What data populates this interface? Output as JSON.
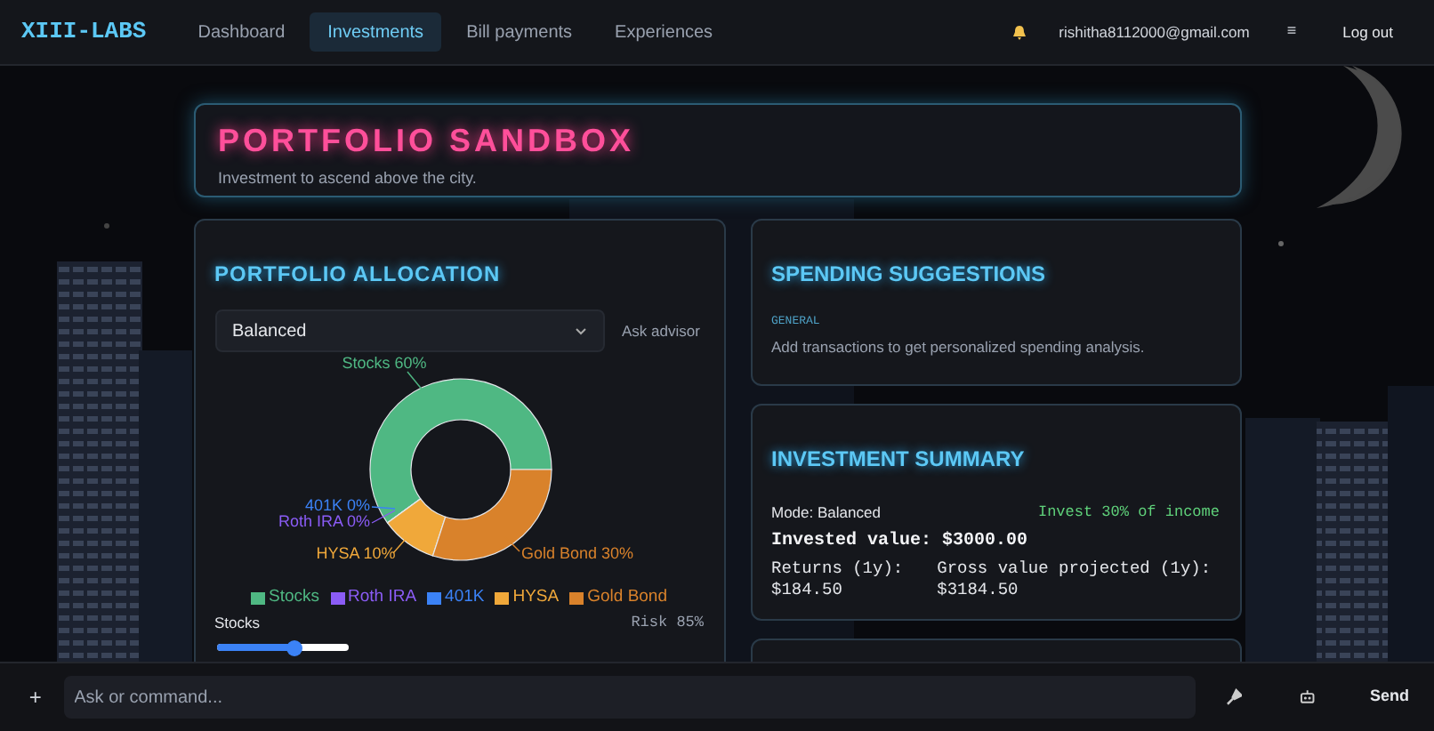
{
  "nav": {
    "logo": "XIII-LABS",
    "tabs": [
      {
        "label": "Dashboard",
        "selected": false
      },
      {
        "label": "Investments",
        "selected": true
      },
      {
        "label": "Bill payments",
        "selected": false
      },
      {
        "label": "Experiences",
        "selected": false
      }
    ],
    "email": "rishitha8112000@gmail.com",
    "menu": "≡",
    "logout": "Log out"
  },
  "header": {
    "title": "PORTFOLIO SANDBOX",
    "subtitle": "Investment to ascend above the city."
  },
  "allocation": {
    "title": "PORTFOLIO ALLOCATION",
    "mode": "Balanced",
    "advisor": "Ask advisor",
    "chart_data": {
      "type": "donut",
      "categories": [
        "Stocks",
        "Roth IRA",
        "401K",
        "HYSA",
        "Gold Bond"
      ],
      "values": [
        60,
        0,
        0,
        10,
        30
      ],
      "value_labels": [
        "Stocks 60%",
        "Roth IRA 0%",
        "401K 0%",
        "HYSA 10%",
        "Gold Bond 30%"
      ]
    },
    "legend": [
      {
        "color": "#4fb883"
      },
      {
        "color": "#8b5cf6"
      },
      {
        "color": "#3b82f6"
      },
      {
        "color": "#f0a83a"
      },
      {
        "color": "#d9822b"
      }
    ],
    "slider": {
      "label": "Stocks",
      "risk": "Risk 85%",
      "level": 0.6
    }
  },
  "spending": {
    "title": "SPENDING SUGGESTIONS",
    "category": "GENERAL",
    "text": "Add transactions to get personalized spending analysis."
  },
  "summary": {
    "title": "INVESTMENT SUMMARY",
    "mode": "Mode: Balanced",
    "advice": "Invest 30% of income",
    "invested": "Invested value: $3000.00",
    "returns_label": "Returns (1y):",
    "returns_value": "$184.50",
    "gross_label": "Gross value projected (1y):",
    "gross_value": "$3184.50"
  },
  "command": {
    "add": "+",
    "placeholder": "Ask or command...",
    "send": "Send"
  }
}
